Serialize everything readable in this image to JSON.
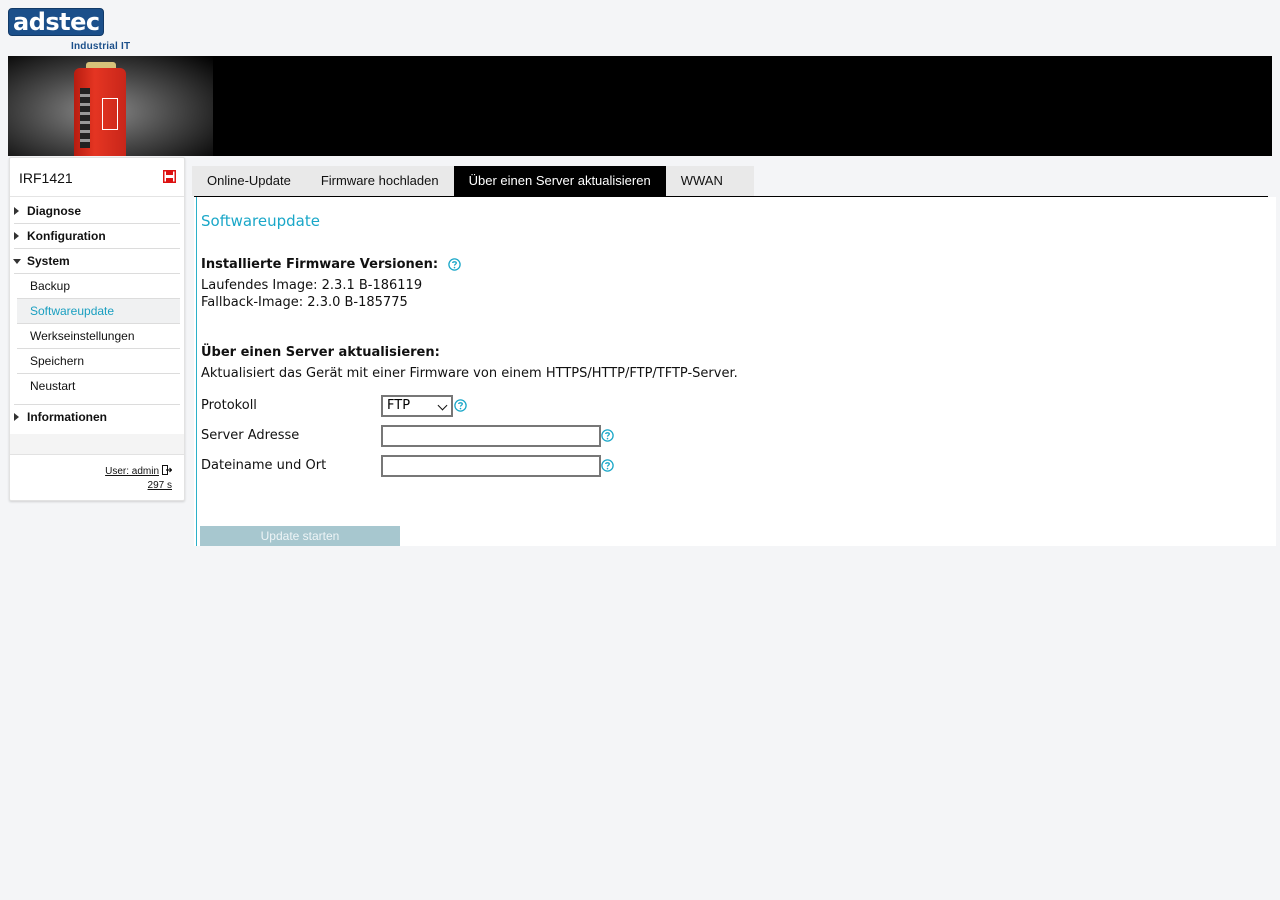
{
  "logo": {
    "brand": "adstec",
    "tagline": "Industrial IT"
  },
  "sidebar": {
    "device_name": "IRF1421",
    "items": [
      {
        "label": "Diagnose",
        "expanded": false
      },
      {
        "label": "Konfiguration",
        "expanded": false
      },
      {
        "label": "System",
        "expanded": true,
        "children": [
          "Backup",
          "Softwareupdate",
          "Werkseinstellungen",
          "Speichern",
          "Neustart"
        ],
        "active_child": "Softwareupdate"
      },
      {
        "label": "Informationen",
        "expanded": false
      }
    ],
    "user": "User: admin",
    "timer": "297 s"
  },
  "tabs": [
    {
      "label": "Online-Update",
      "active": false
    },
    {
      "label": "Firmware hochladen",
      "active": false
    },
    {
      "label": "Über einen Server aktualisieren",
      "active": true
    },
    {
      "label": "WWAN",
      "active": false
    }
  ],
  "main": {
    "title": "Softwareupdate",
    "firmware_heading": "Installierte Firmware Versionen:",
    "running_image": "Laufendes Image: 2.3.1 B-186119",
    "fallback_image": "Fallback-Image: 2.3.0 B-185775",
    "server_heading": "Über einen Server aktualisieren:",
    "server_desc": "Aktualisiert das Gerät mit einer Firmware von einem HTTPS/HTTP/FTP/TFTP-Server.",
    "form": {
      "protocol_label": "Protokoll",
      "protocol_value": "FTP",
      "server_label": "Server Adresse",
      "server_value": "",
      "file_label": "Dateiname und Ort",
      "file_value": ""
    },
    "update_button": "Update starten"
  },
  "colors": {
    "accent": "#1aa7c8",
    "brand": "#1b4f8a",
    "button_disabled": "#a7c7cf"
  }
}
